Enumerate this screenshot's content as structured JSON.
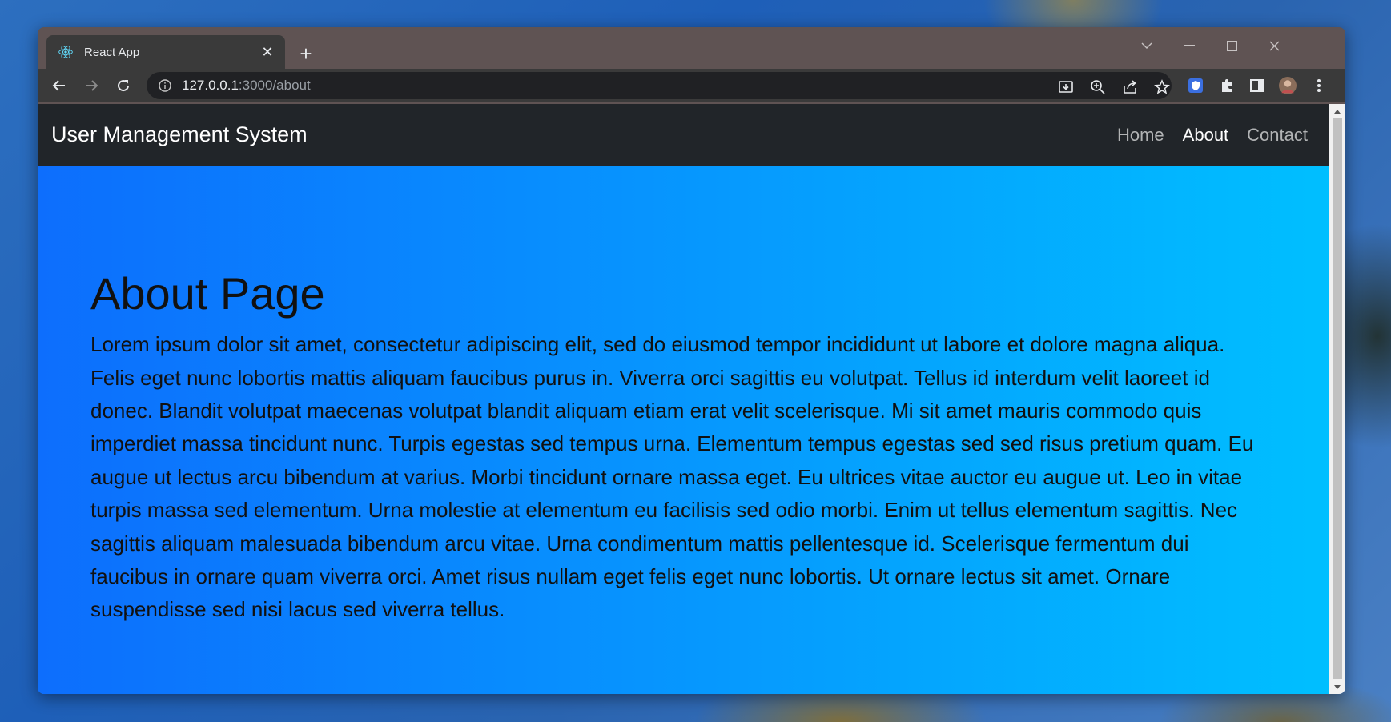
{
  "browser": {
    "tab": {
      "title": "React App",
      "favicon": "react-logo-icon",
      "close_glyph": "✕"
    },
    "new_tab_glyph": "+",
    "address": {
      "host": "127.0.0.1",
      "rest": ":3000/about"
    }
  },
  "app": {
    "brand": "User Management System",
    "nav": [
      {
        "label": "Home",
        "active": false
      },
      {
        "label": "About",
        "active": true
      },
      {
        "label": "Contact",
        "active": false
      }
    ]
  },
  "page": {
    "title": "About Page",
    "body": "Lorem ipsum dolor sit amet, consectetur adipiscing elit, sed do eiusmod tempor incididunt ut labore et dolore magna aliqua. Felis eget nunc lobortis mattis aliquam faucibus purus in. Viverra orci sagittis eu volutpat. Tellus id interdum velit laoreet id donec. Blandit volutpat maecenas volutpat blandit aliquam etiam erat velit scelerisque. Mi sit amet mauris commodo quis imperdiet massa tincidunt nunc. Turpis egestas sed tempus urna. Elementum tempus egestas sed sed risus pretium quam. Eu augue ut lectus arcu bibendum at varius. Morbi tincidunt ornare massa eget. Eu ultrices vitae auctor eu augue ut. Leo in vitae turpis massa sed elementum. Urna molestie at elementum eu facilisis sed odio morbi. Enim ut tellus elementum sagittis. Nec sagittis aliquam malesuada bibendum arcu vitae. Urna condimentum mattis pellentesque id. Scelerisque fermentum dui faucibus in ornare quam viverra orci. Amet risus nullam eget felis eget nunc lobortis. Ut ornare lectus sit amet. Ornare suspendisse sed nisi lacus sed viverra tellus."
  },
  "colors": {
    "navbar_bg": "#212529",
    "gradient_start": "#0d6efd",
    "gradient_end": "#00bfff",
    "chrome_frame": "#5f5353"
  }
}
